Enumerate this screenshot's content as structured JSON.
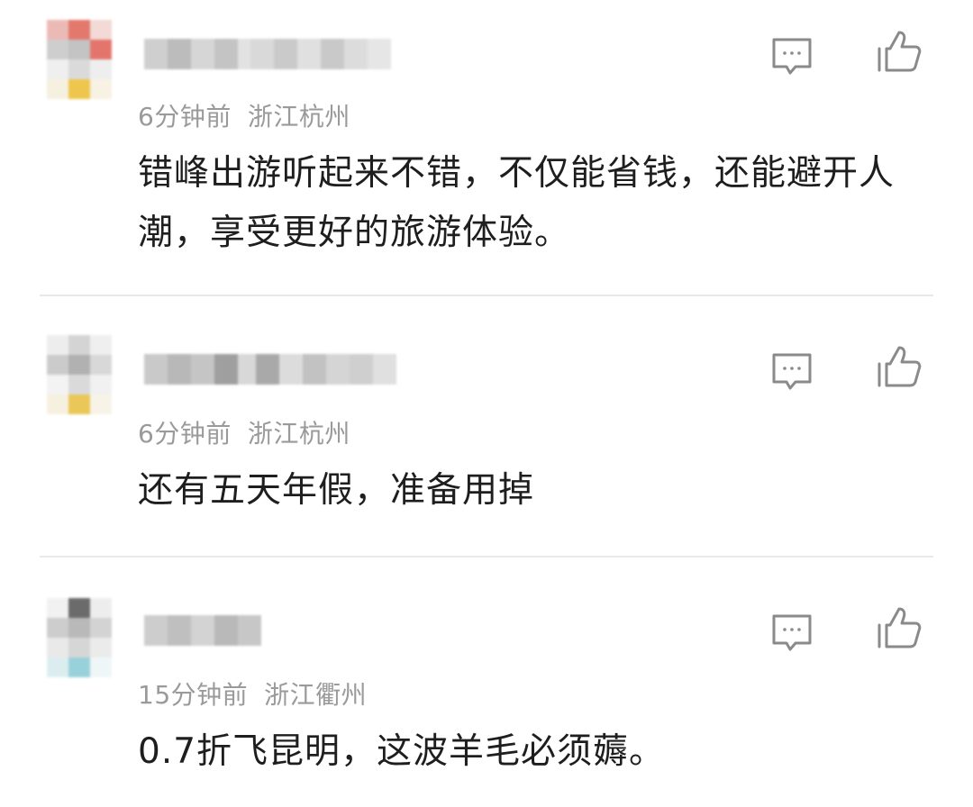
{
  "comments": [
    {
      "time": "6分钟前",
      "location": "浙江杭州",
      "text": "错峰出游听起来不错，不仅能省钱，还能避开人潮，享受更好的旅游体验。",
      "reply_icon": "comment-icon",
      "like_icon": "thumbs-up-icon"
    },
    {
      "time": "6分钟前",
      "location": "浙江杭州",
      "text": "还有五天年假，准备用掉",
      "reply_icon": "comment-icon",
      "like_icon": "thumbs-up-icon"
    },
    {
      "time": "15分钟前",
      "location": "浙江衢州",
      "text": "0.7折飞昆明，这波羊毛必须薅。",
      "reply_icon": "comment-icon",
      "like_icon": "thumbs-up-icon"
    }
  ],
  "colors": {
    "meta_text": "#9a9a9a",
    "body_text": "#1e1e1e",
    "icon_stroke": "#8a8a8a",
    "divider": "#e9e9e9"
  }
}
